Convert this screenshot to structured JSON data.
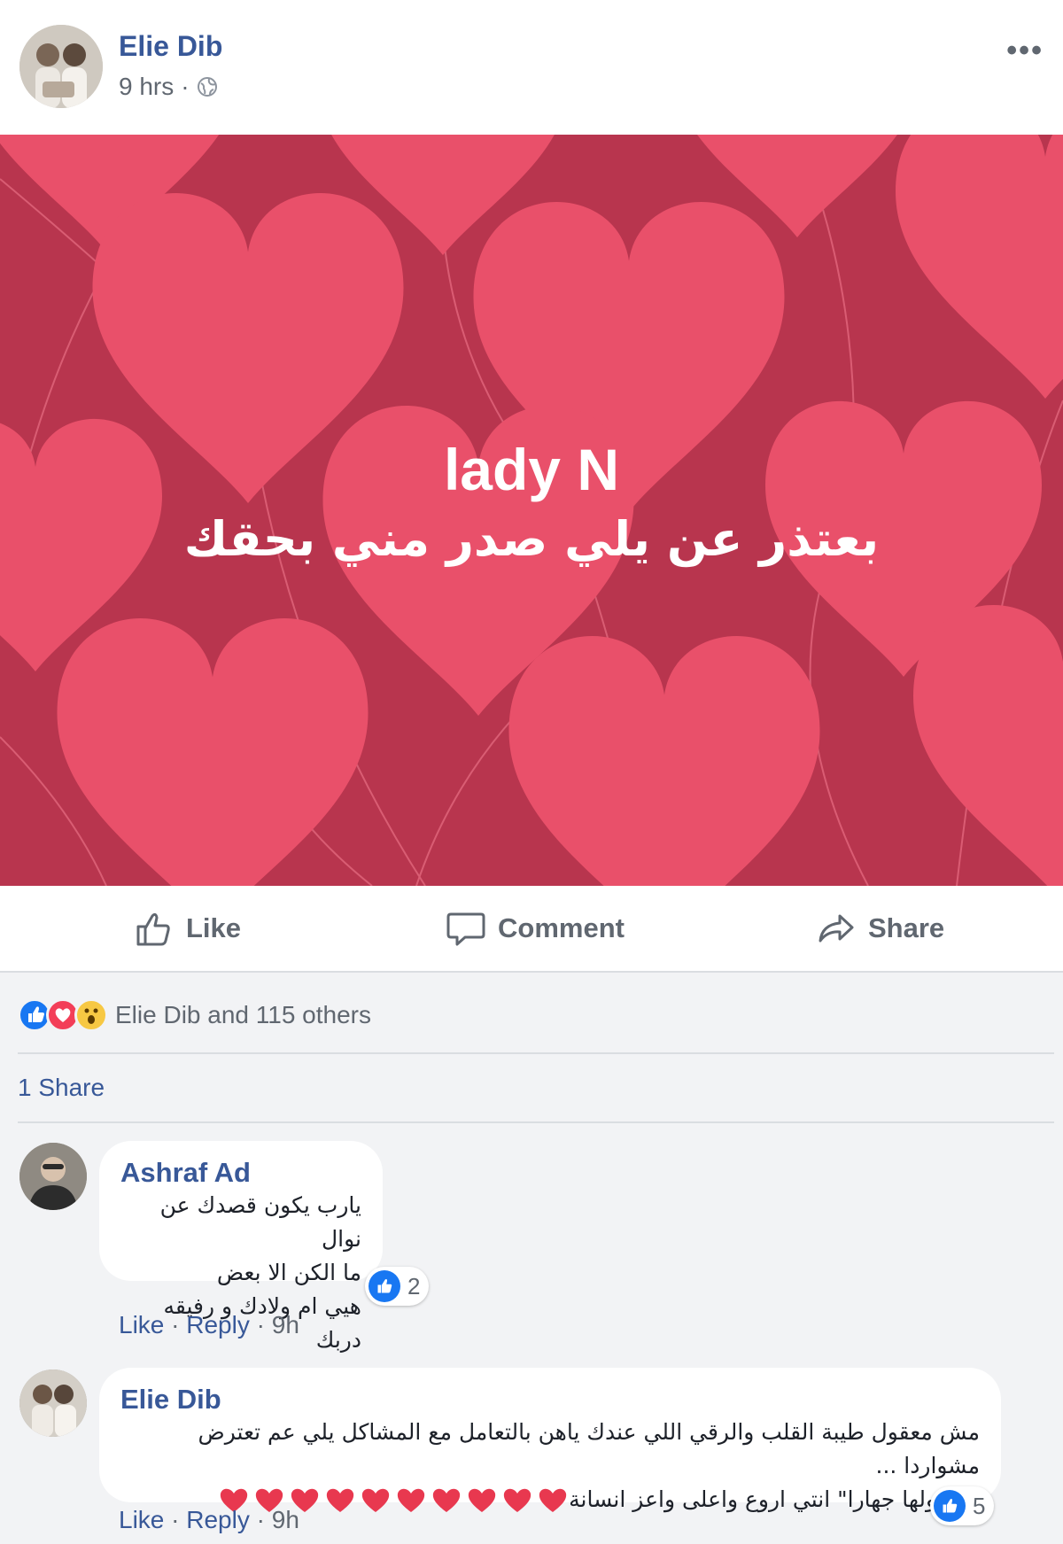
{
  "post": {
    "author": "Elie Dib",
    "time": "9 hrs",
    "separator": "·",
    "more_label": "•••"
  },
  "banner": {
    "title": "lady N",
    "subtitle": "بعتذر عن يلي صدر مني بحقك",
    "colors": {
      "background": "#b8354e",
      "heart": "#e9506a"
    }
  },
  "actions": {
    "like": "Like",
    "comment": "Comment",
    "share": "Share"
  },
  "reactions": {
    "icons": [
      "like-icon",
      "love-icon",
      "wow-icon"
    ],
    "text": "Elie Dib and 115 others"
  },
  "shares": "1 Share",
  "comments": [
    {
      "name": "Ashraf Ad",
      "lines": [
        "يارب يكون قصدك عن نوال",
        "ما الكن الا بعض",
        "هيي ام ولادك و رفيقه دربك"
      ],
      "likes": "2",
      "like_label": "Like",
      "reply_label": "Reply",
      "time": "9h"
    },
    {
      "name": "Elie Dib",
      "lines": [
        "مش معقول طيبة القلب والرقي اللي عندك ياهن بالتعامل مع المشاكل يلي عم تعترض مشواردا ...",
        "رح قولها جهارا\" انتي اروع واعلى واعز انسانة"
      ],
      "heart_count": 10,
      "likes": "5",
      "like_label": "Like",
      "reply_label": "Reply",
      "time": "9h"
    }
  ]
}
